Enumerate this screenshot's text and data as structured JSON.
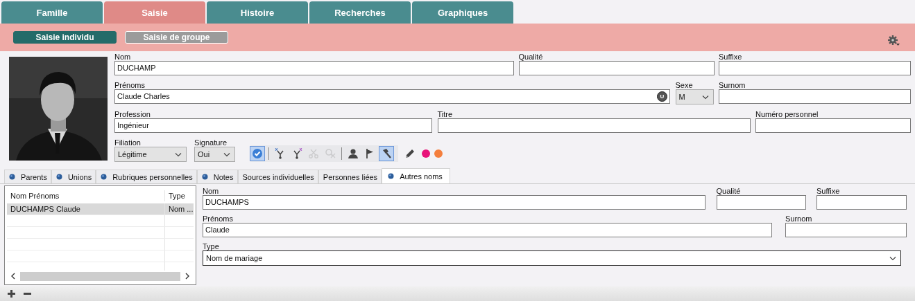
{
  "top_tabs": [
    {
      "label": "Famille",
      "selected": false
    },
    {
      "label": "Saisie",
      "selected": true
    },
    {
      "label": "Histoire",
      "selected": false
    },
    {
      "label": "Recherches",
      "selected": false
    },
    {
      "label": "Graphiques",
      "selected": false
    }
  ],
  "sub_tabs": [
    {
      "label": "Saisie individu",
      "selected": true
    },
    {
      "label": "Saisie de groupe",
      "selected": false
    }
  ],
  "photo": {
    "kind": "picture"
  },
  "form_rows": [
    [
      {
        "label": "Nom",
        "kind": "text",
        "value": "DUCHAMP"
      },
      {
        "label": "Qualité",
        "kind": "text"
      },
      {
        "label": "Suffixe",
        "kind": "text"
      }
    ],
    [
      {
        "label": "Prénoms",
        "kind": "text",
        "value": "Claude Charles",
        "badge": "U"
      },
      {
        "label": "Sexe",
        "kind": "select",
        "value": "M"
      },
      {
        "label": "Surnom",
        "kind": "text"
      }
    ],
    [
      {
        "label": "Profession",
        "kind": "text",
        "value": "Ingénieur"
      },
      {
        "label": "Titre",
        "kind": "text"
      },
      {
        "label": "Numéro personnel",
        "kind": "text"
      }
    ],
    [
      {
        "label": "Filiation",
        "kind": "select",
        "value": "Légitime"
      },
      {
        "label": "Signature",
        "kind": "select",
        "value": "Oui"
      }
    ]
  ],
  "toolbar": {
    "groups": [
      [
        {
          "kind": "check",
          "selected": true,
          "disabled": false
        }
      ],
      [
        {
          "kind": "fork",
          "selected": false,
          "disabled": false
        },
        {
          "kind": "forkx",
          "selected": false,
          "disabled": false
        },
        {
          "kind": "scissors",
          "selected": false,
          "disabled": true
        },
        {
          "kind": "unlink",
          "selected": false,
          "disabled": true
        }
      ],
      [
        {
          "kind": "person",
          "selected": false,
          "disabled": false
        },
        {
          "kind": "flag",
          "selected": false,
          "disabled": false
        },
        {
          "kind": "hammer",
          "selected": true,
          "disabled": false
        }
      ]
    ],
    "markers": [
      {
        "kind": "pencil"
      },
      {
        "kind": "dot",
        "color": "#e8137a"
      },
      {
        "kind": "dot",
        "color": "#f47f3d"
      }
    ]
  },
  "bottom_tabs": [
    {
      "label": "Parents",
      "marked": true,
      "selected": false
    },
    {
      "label": "Unions",
      "marked": true,
      "selected": false
    },
    {
      "label": "Rubriques personnelles",
      "marked": true,
      "selected": false
    },
    {
      "label": "Notes",
      "marked": true,
      "selected": false
    },
    {
      "label": "Sources individuelles",
      "marked": false,
      "selected": false
    },
    {
      "label": "Personnes liées",
      "marked": false,
      "selected": false
    },
    {
      "label": "Autres noms",
      "marked": true,
      "selected": true
    }
  ],
  "names_list": {
    "columns": [
      "Nom Prénoms",
      "Type"
    ],
    "rows": [
      {
        "cells": [
          "DUCHAMPS Claude",
          "Nom ..."
        ],
        "selected": true
      }
    ]
  },
  "detail_rows": [
    [
      {
        "label": "Nom",
        "kind": "text",
        "value": "DUCHAMPS"
      },
      {
        "label": "Qualité",
        "kind": "text"
      },
      {
        "label": "Suffixe",
        "kind": "text"
      }
    ],
    [
      {
        "label": "Prénoms",
        "kind": "text",
        "value": "Claude"
      },
      {
        "label": "Surnom",
        "kind": "text"
      }
    ],
    [
      {
        "label": "Type",
        "kind": "select",
        "value": "Nom de mariage"
      }
    ]
  ]
}
